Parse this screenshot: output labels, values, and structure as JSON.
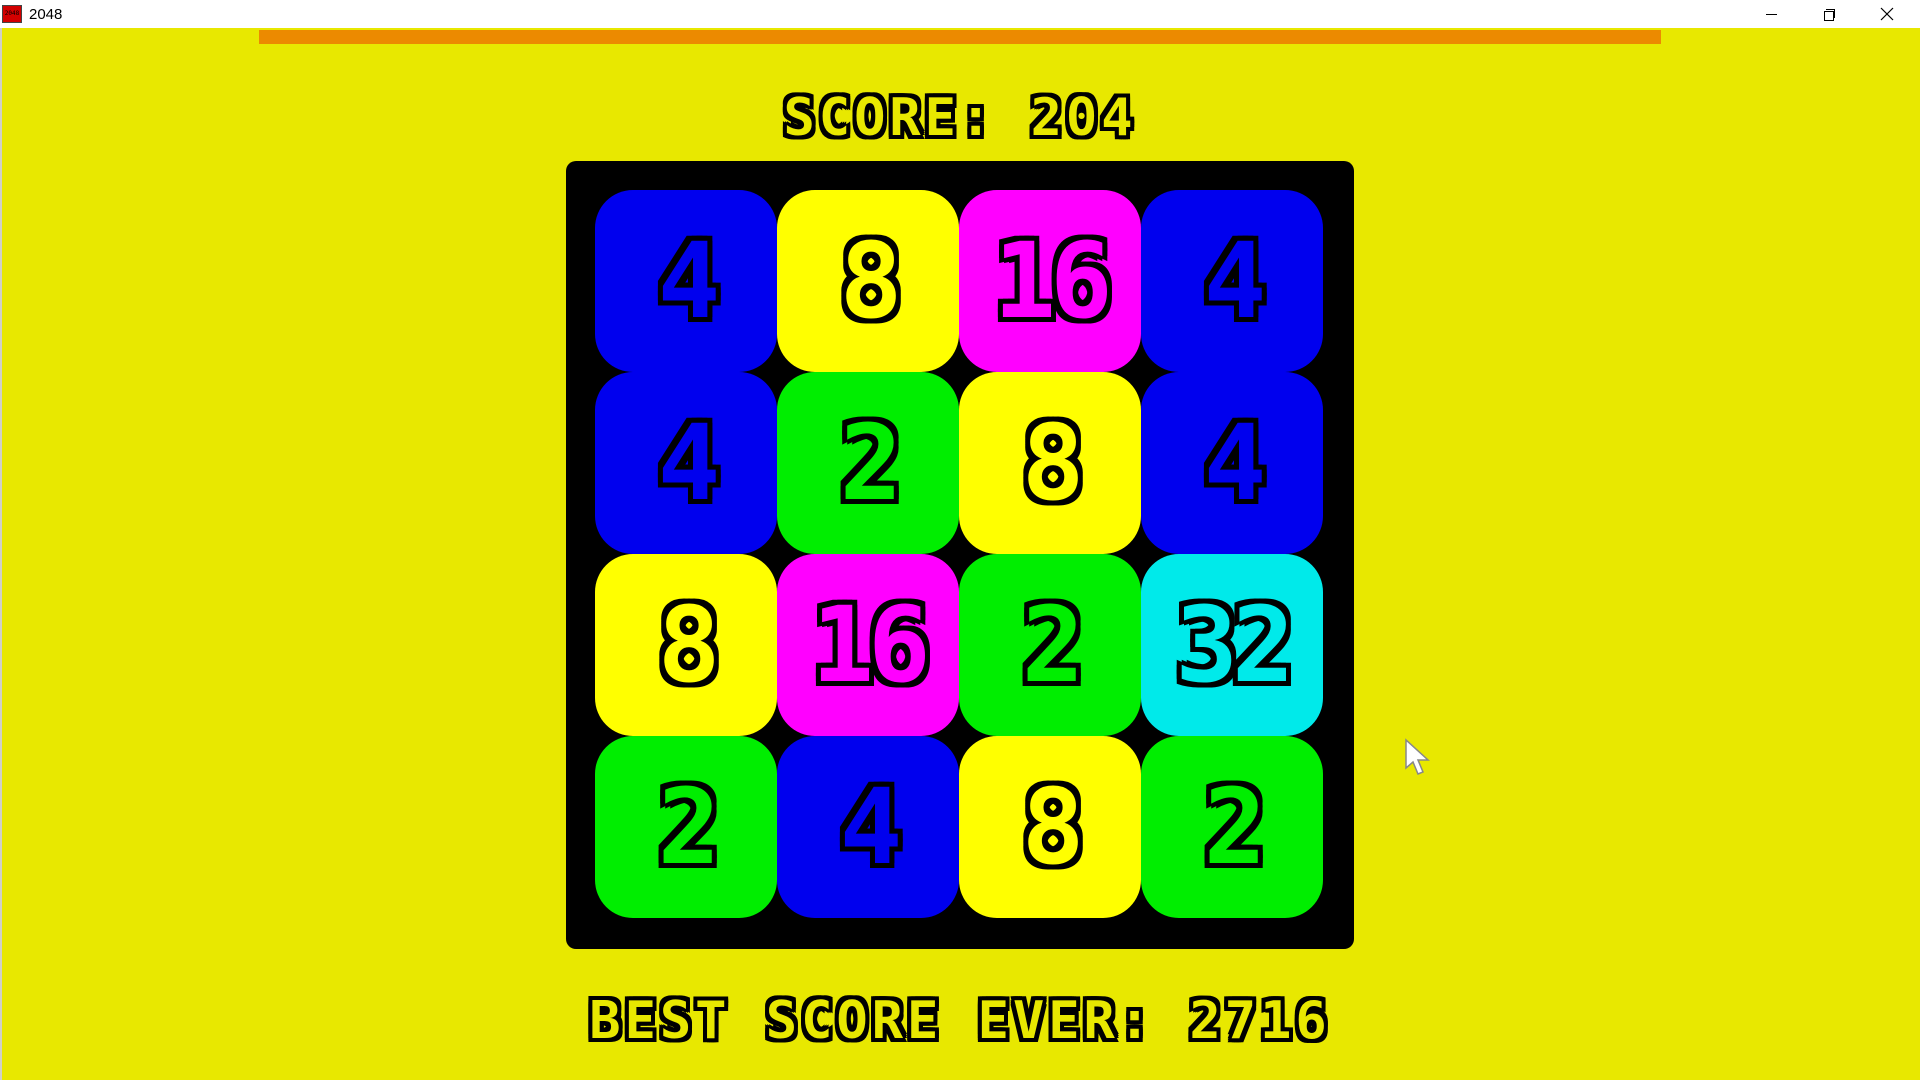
{
  "window": {
    "title": "2048",
    "icon": "2048-app-icon",
    "controls": [
      "minimize-icon",
      "maximize-icon",
      "close-icon"
    ]
  },
  "game": {
    "background_color": "#e8e800",
    "progress": {
      "color": "#ec8a00",
      "fraction": 1.0
    },
    "score_label": "SCORE:",
    "score_value": "204",
    "best_label": "BEST SCORE EVER:",
    "best_value": "2716",
    "tile_colors": {
      "2": "#00ee00",
      "4": "#0000ee",
      "8": "#ffff00",
      "16": "#ff00ff",
      "32": "#00eaea"
    },
    "board": [
      [
        "4",
        "8",
        "16",
        "4"
      ],
      [
        "4",
        "2",
        "8",
        "4"
      ],
      [
        "8",
        "16",
        "2",
        "32"
      ],
      [
        "2",
        "4",
        "8",
        "2"
      ]
    ]
  }
}
